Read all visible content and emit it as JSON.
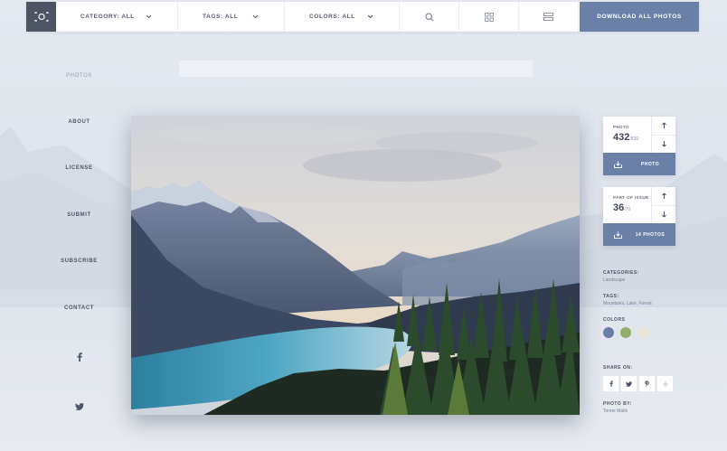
{
  "topbar": {
    "logo_icon": "camera-icon",
    "category_label": "CATEGORY: ALL",
    "tags_label": "TAGS: ALL",
    "colors_label": "COLORS: ALL",
    "search_icon": "search-icon",
    "grid_icon": "grid-view-icon",
    "list_icon": "list-view-icon",
    "download_all_label": "DOWNLOAD ALL PHOTOS"
  },
  "nav": {
    "photos": "PHOTOS",
    "about": "ABOUT",
    "license": "LICENSE",
    "submit": "SUBMIT",
    "subscribe": "SUBSCRIBE",
    "contact": "CONTACT",
    "facebook_icon": "facebook-icon",
    "twitter_icon": "twitter-icon"
  },
  "photo_card": {
    "label": "PHOTO",
    "current": "432",
    "total": "/839",
    "button_label": "PHOTO"
  },
  "issue_card": {
    "label": "PART OF ISSUE",
    "current": "36",
    "total": "/70",
    "button_label": "14 PHOTOS"
  },
  "meta": {
    "categories_label": "CATEGORIES:",
    "categories_value": "Landscape",
    "tags_label": "TAGS:",
    "tags_value": "Mountains, Lake, Forest",
    "colors_label": "COLORS",
    "colors": [
      "#6b7fa6",
      "#93ad6e",
      "#ece4d6"
    ],
    "share_label": "SHARE ON:",
    "share_icons": [
      "facebook-icon",
      "twitter-icon",
      "pinterest-icon",
      "plus-icon"
    ],
    "photo_by_label": "PHOTO BY:",
    "photo_by_value": "Tomer Malik"
  },
  "accent": "#6a80a6"
}
